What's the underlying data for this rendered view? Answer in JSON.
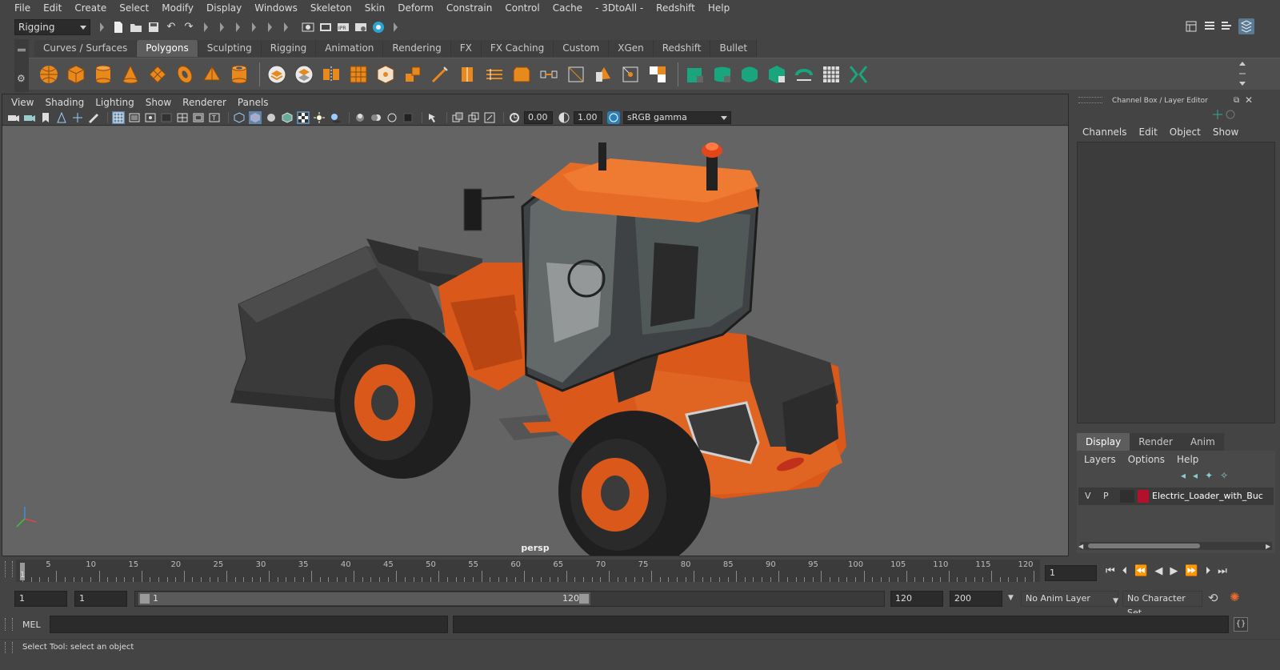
{
  "menubar": {
    "items": [
      "File",
      "Edit",
      "Create",
      "Select",
      "Modify",
      "Display",
      "Windows",
      "Skeleton",
      "Skin",
      "Deform",
      "Constrain",
      "Control",
      "Cache",
      "- 3DtoAll -",
      "Redshift",
      "Help"
    ]
  },
  "statusline": {
    "mode_dropdown": "Rigging"
  },
  "shelf": {
    "tabs": [
      "Curves / Surfaces",
      "Polygons",
      "Sculpting",
      "Rigging",
      "Animation",
      "Rendering",
      "FX",
      "FX Caching",
      "Custom",
      "XGen",
      "Redshift",
      "Bullet"
    ],
    "active_tab": "Polygons"
  },
  "viewport": {
    "menus": [
      "View",
      "Shading",
      "Lighting",
      "Show",
      "Renderer",
      "Panels"
    ],
    "exposure": "0.00",
    "gamma": "1.00",
    "color_space": "sRGB gamma",
    "camera_label": "persp",
    "body_color": "#d9581a"
  },
  "right_panel": {
    "title": "Channel Box / Layer Editor",
    "channel_menus": [
      "Channels",
      "Edit",
      "Object",
      "Show"
    ],
    "layer_tabs": [
      "Display",
      "Render",
      "Anim"
    ],
    "active_layer_tab": "Display",
    "layer_menus": [
      "Layers",
      "Options",
      "Help"
    ],
    "layer": {
      "v": "V",
      "p": "P",
      "name": "Electric_Loader_with_Buc",
      "color": "#b3102b"
    }
  },
  "timeline": {
    "ticks": [
      "5",
      "10",
      "15",
      "20",
      "25",
      "30",
      "35",
      "40",
      "45",
      "50",
      "55",
      "60",
      "65",
      "70",
      "75",
      "80",
      "85",
      "90",
      "95",
      "100",
      "105",
      "110",
      "115",
      "120"
    ],
    "first_frame": "1",
    "current_frame": "1"
  },
  "range": {
    "start": "1",
    "anim_start": "1",
    "slider_start": "1",
    "slider_end": "120",
    "anim_end": "120",
    "end": "200",
    "anim_layer": "No Anim Layer",
    "character_set": "No Character Set"
  },
  "cmdline": {
    "label": "MEL"
  },
  "helpline": {
    "text": "Select Tool: select an object"
  }
}
